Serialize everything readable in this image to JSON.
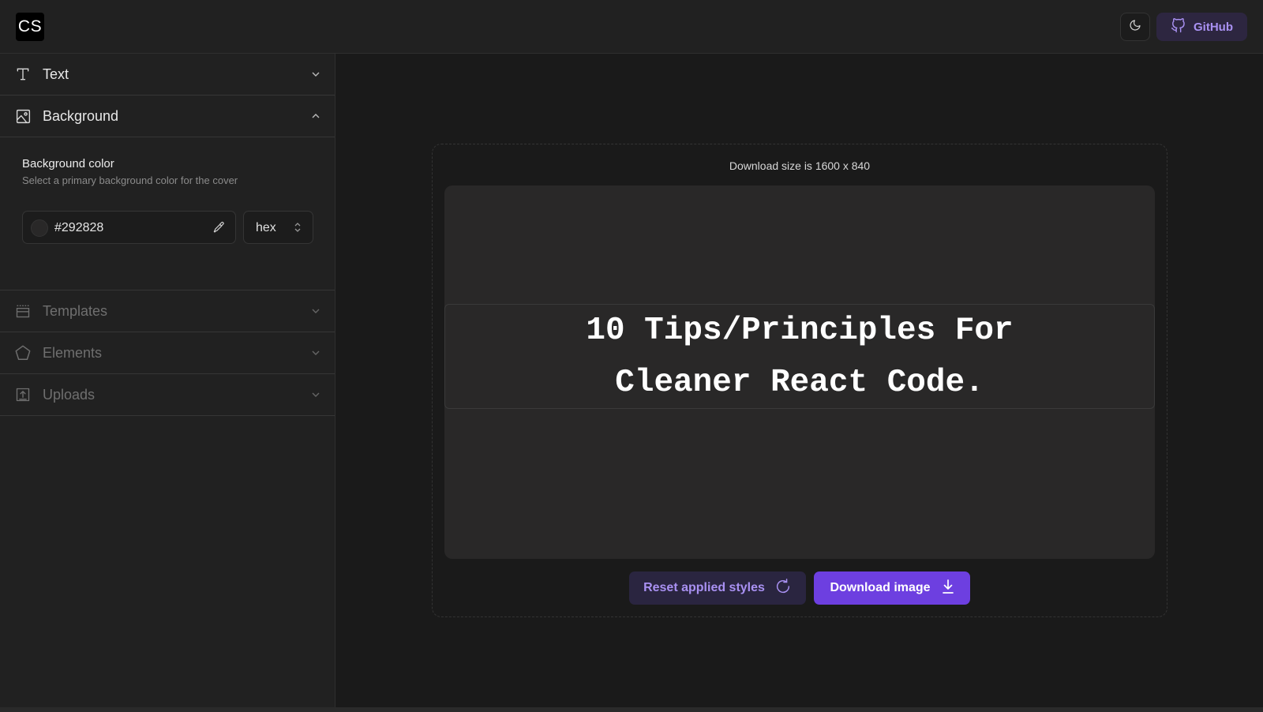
{
  "header": {
    "logo_text": "CS",
    "theme_icon": "moon-icon",
    "github_label": "GitHub",
    "github_icon": "github-icon",
    "accent_color": "#a991f2"
  },
  "sidebar": {
    "sections": [
      {
        "label": "Text",
        "icon": "text-icon",
        "expanded": false
      },
      {
        "label": "Background",
        "icon": "image-icon",
        "expanded": true
      },
      {
        "label": "Templates",
        "icon": "template-icon",
        "expanded": false
      },
      {
        "label": "Elements",
        "icon": "pentagon-icon",
        "expanded": false
      },
      {
        "label": "Uploads",
        "icon": "upload-icon",
        "expanded": false
      }
    ],
    "background": {
      "title": "Background color",
      "description": "Select a primary background color for the cover",
      "color_value": "#292828",
      "format": "hex"
    }
  },
  "canvas": {
    "download_size_text": "Download size is 1600 x 840",
    "cover_line1": "10 Tips/Principles For",
    "cover_line2": "Cleaner React Code.",
    "cover_background": "#292828",
    "reset_label": "Reset applied styles",
    "download_label": "Download image",
    "primary_color": "#6d3fe0"
  }
}
